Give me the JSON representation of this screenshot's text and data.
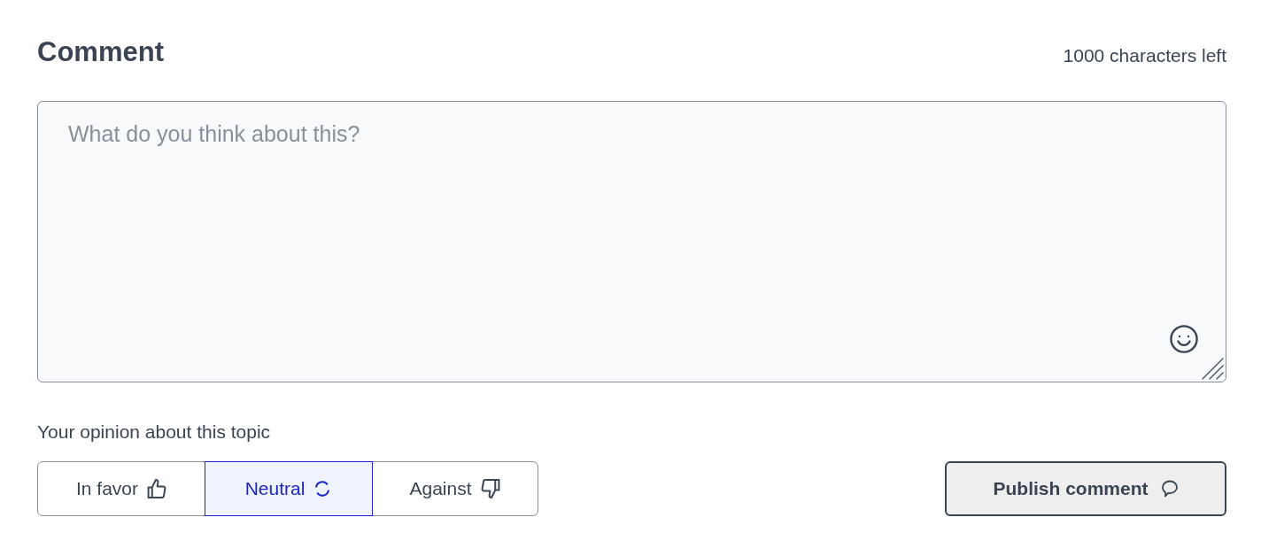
{
  "comment": {
    "title": "Comment",
    "counter": "1000 characters left",
    "placeholder": "What do you think about this?"
  },
  "opinion": {
    "label": "Your opinion about this topic",
    "options": [
      {
        "label": "In favor",
        "kind": "favor",
        "selected": false
      },
      {
        "label": "Neutral",
        "kind": "neutral",
        "selected": true
      },
      {
        "label": "Against",
        "kind": "against",
        "selected": false
      }
    ]
  },
  "publish_button": {
    "label": "Publish comment"
  }
}
